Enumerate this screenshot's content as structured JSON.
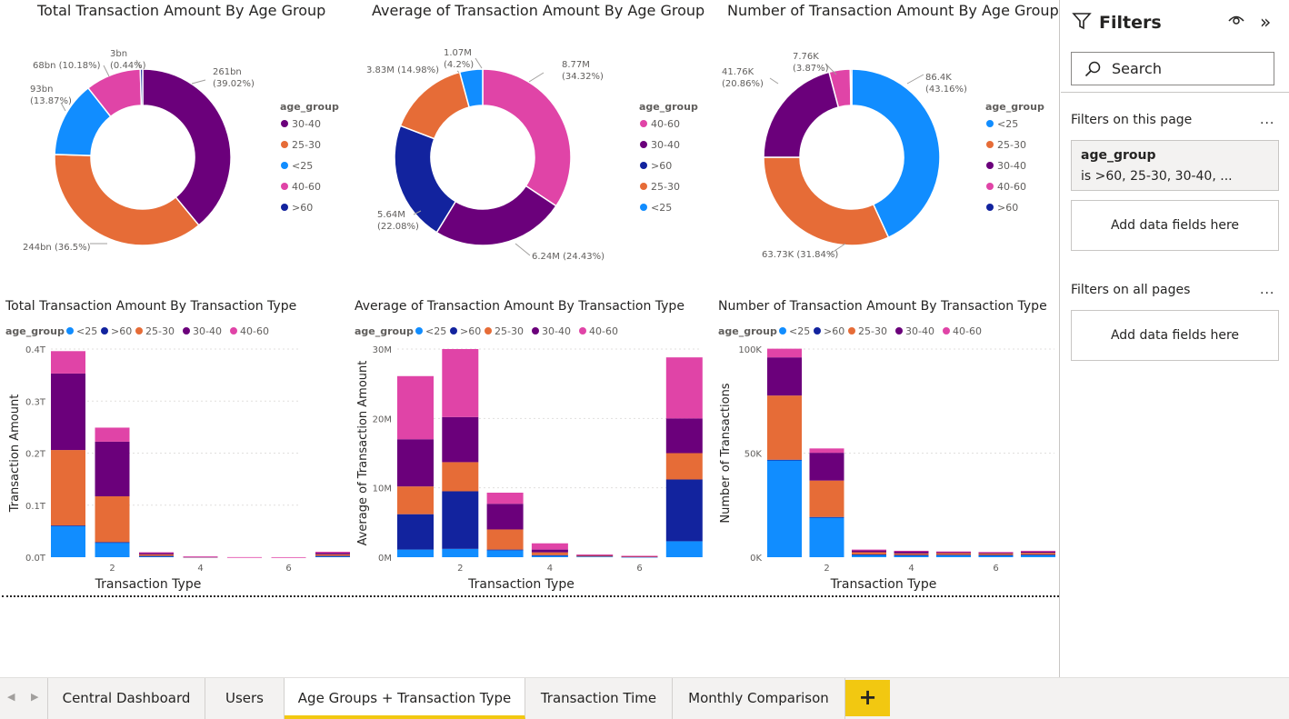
{
  "colors": {
    "lt25": "#118dff",
    "gt60": "#12239e",
    "c25_30": "#e66c37",
    "c30_40": "#6b007b",
    "c40_60": "#e044a7"
  },
  "donuts": [
    {
      "title": "Total Transaction Amount By Age Group",
      "legend_title": "age_group",
      "legend": [
        "30-40",
        "25-30",
        "<25",
        "40-60",
        ">60"
      ],
      "slices": [
        {
          "group": "30-40",
          "label": "261bn",
          "pct": "(39.02%)",
          "value": 39.02,
          "color": "#6b007b"
        },
        {
          "group": "25-30",
          "label": "244bn (36.5%)",
          "pct": "",
          "value": 36.5,
          "color": "#e66c37"
        },
        {
          "group": "<25",
          "label": "93bn",
          "pct": "(13.87%)",
          "value": 13.87,
          "color": "#118dff"
        },
        {
          "group": "40-60",
          "label": "68bn (10.18%)",
          "pct": "",
          "value": 10.18,
          "color": "#e044a7"
        },
        {
          "group": ">60",
          "label": "3bn",
          "pct": "(0.44%)",
          "value": 0.44,
          "color": "#12239e"
        }
      ]
    },
    {
      "title": "Average of Transaction Amount By Age Group",
      "legend_title": "age_group",
      "legend": [
        "40-60",
        "30-40",
        ">60",
        "25-30",
        "<25"
      ],
      "slices": [
        {
          "group": "40-60",
          "label": "8.77M",
          "pct": "(34.32%)",
          "value": 34.32,
          "color": "#e044a7"
        },
        {
          "group": "30-40",
          "label": "6.24M (24.43%)",
          "pct": "",
          "value": 24.43,
          "color": "#6b007b"
        },
        {
          "group": ">60",
          "label": "5.64M",
          "pct": "(22.08%)",
          "value": 22.08,
          "color": "#12239e"
        },
        {
          "group": "25-30",
          "label": "3.83M (14.98%)",
          "pct": "",
          "value": 14.98,
          "color": "#e66c37"
        },
        {
          "group": "<25",
          "label": "1.07M",
          "pct": "(4.2%)",
          "value": 4.2,
          "color": "#118dff"
        }
      ]
    },
    {
      "title": "Number of Transaction Amount By Age Group",
      "legend_title": "age_group",
      "legend": [
        "<25",
        "25-30",
        "30-40",
        "40-60",
        ">60"
      ],
      "slices": [
        {
          "group": "<25",
          "label": "86.4K",
          "pct": "(43.16%)",
          "value": 43.16,
          "color": "#118dff"
        },
        {
          "group": "25-30",
          "label": "63.73K (31.84%)",
          "pct": "",
          "value": 31.84,
          "color": "#e66c37"
        },
        {
          "group": "30-40",
          "label": "41.76K",
          "pct": "(20.86%)",
          "value": 20.86,
          "color": "#6b007b"
        },
        {
          "group": "40-60",
          "label": "7.76K",
          "pct": "(3.87%)",
          "value": 3.87,
          "color": "#e044a7"
        },
        {
          "group": ">60",
          "label": "",
          "pct": "",
          "value": 0.27,
          "color": "#12239e"
        }
      ]
    }
  ],
  "chart_data": [
    {
      "type": "pie",
      "title": "Total Transaction Amount By Age Group",
      "legend_title": "age_group",
      "labels": [
        "30-40",
        "25-30",
        "<25",
        "40-60",
        ">60"
      ],
      "values_bn": [
        261,
        244,
        93,
        68,
        3
      ],
      "percent": [
        39.02,
        36.5,
        13.87,
        10.18,
        0.44
      ]
    },
    {
      "type": "pie",
      "title": "Average of Transaction Amount By Age Group",
      "legend_title": "age_group",
      "labels": [
        "40-60",
        "30-40",
        ">60",
        "25-30",
        "<25"
      ],
      "values_M": [
        8.77,
        6.24,
        5.64,
        3.83,
        1.07
      ],
      "percent": [
        34.32,
        24.43,
        22.08,
        14.98,
        4.2
      ]
    },
    {
      "type": "pie",
      "title": "Number of Transaction Amount By Age Group",
      "legend_title": "age_group",
      "labels": [
        "<25",
        "25-30",
        "30-40",
        "40-60"
      ],
      "values_K": [
        86.4,
        63.73,
        41.76,
        7.76
      ],
      "percent": [
        43.16,
        31.84,
        20.86,
        3.87
      ]
    },
    {
      "type": "bar",
      "stacked": true,
      "title": "Total Transaction Amount By Transaction Type",
      "legend_title": "age_group",
      "legend": [
        "<25",
        ">60",
        "25-30",
        "30-40",
        "40-60"
      ],
      "xlabel": "Transaction Type",
      "ylabel": "Transaction Amount",
      "x": [
        1,
        2,
        3,
        4,
        5,
        6,
        7
      ],
      "xticks": [
        "2",
        "4",
        "6"
      ],
      "yticks": [
        "0.0T",
        "0.1T",
        "0.2T",
        "0.3T",
        "0.4T"
      ],
      "ylim": [
        0,
        0.4
      ],
      "series": [
        {
          "name": "<25",
          "color": "#118dff",
          "values": [
            0.06,
            0.028,
            0.002,
            0.0005,
            0,
            0,
            0.002
          ]
        },
        {
          "name": ">60",
          "color": "#12239e",
          "values": [
            0.001,
            0.001,
            0.0005,
            0,
            0,
            0,
            0.0005
          ]
        },
        {
          "name": "25-30",
          "color": "#e66c37",
          "values": [
            0.145,
            0.088,
            0.003,
            0.0003,
            0,
            0,
            0.003
          ]
        },
        {
          "name": "30-40",
          "color": "#6b007b",
          "values": [
            0.147,
            0.105,
            0.003,
            0.0002,
            0,
            0,
            0.003
          ]
        },
        {
          "name": "40-60",
          "color": "#e044a7",
          "values": [
            0.043,
            0.027,
            0.001,
            0.0005,
            0.0002,
            0.0001,
            0.002
          ]
        }
      ]
    },
    {
      "type": "bar",
      "stacked": true,
      "title": "Average of Transaction Amount By Transaction Type",
      "legend_title": "age_group",
      "legend": [
        "<25",
        ">60",
        "25-30",
        "30-40",
        "40-60"
      ],
      "xlabel": "Transaction Type",
      "ylabel": "Average of Transaction Amount",
      "x": [
        1,
        2,
        3,
        4,
        5,
        6,
        7
      ],
      "xticks": [
        "2",
        "4",
        "6"
      ],
      "yticks": [
        "0M",
        "10M",
        "20M",
        "30M"
      ],
      "ylim": [
        0,
        30
      ],
      "series": [
        {
          "name": "<25",
          "color": "#118dff",
          "values": [
            1.1,
            1.2,
            1.0,
            0.2,
            0.1,
            0.05,
            2.3
          ]
        },
        {
          "name": ">60",
          "color": "#12239e",
          "values": [
            5.1,
            8.3,
            0.1,
            0.1,
            0,
            0,
            8.9
          ]
        },
        {
          "name": "25-30",
          "color": "#e66c37",
          "values": [
            4.0,
            4.2,
            2.9,
            0.4,
            0.1,
            0.05,
            3.8
          ]
        },
        {
          "name": "30-40",
          "color": "#6b007b",
          "values": [
            6.8,
            6.5,
            3.7,
            0.4,
            0.1,
            0.05,
            5.0
          ]
        },
        {
          "name": "40-60",
          "color": "#e044a7",
          "values": [
            9.1,
            9.8,
            1.6,
            0.9,
            0.1,
            0.05,
            8.8
          ]
        }
      ]
    },
    {
      "type": "bar",
      "stacked": true,
      "title": "Number of Transaction Amount By Transaction Type",
      "legend_title": "age_group",
      "legend": [
        "<25",
        ">60",
        "25-30",
        "30-40",
        "40-60"
      ],
      "xlabel": "Transaction Type",
      "ylabel": "Number of Transactions",
      "x": [
        1,
        2,
        3,
        4,
        5,
        6,
        7
      ],
      "xticks": [
        "2",
        "4",
        "6"
      ],
      "yticks": [
        "0K",
        "50K",
        "100K"
      ],
      "ylim": [
        0,
        120
      ],
      "series": [
        {
          "name": "<25",
          "color": "#118dff",
          "values": [
            56,
            23,
            1.5,
            1.2,
            1.3,
            1.2,
            1.4
          ]
        },
        {
          "name": ">60",
          "color": "#12239e",
          "values": [
            0.2,
            0.2,
            0.1,
            0.1,
            0.1,
            0.1,
            0.1
          ]
        },
        {
          "name": "25-30",
          "color": "#e66c37",
          "values": [
            37,
            21,
            1.3,
            0.9,
            1.0,
            0.9,
            1.0
          ]
        },
        {
          "name": "30-40",
          "color": "#6b007b",
          "values": [
            22,
            16,
            1.0,
            1.2,
            0.6,
            0.5,
            0.8
          ]
        },
        {
          "name": "40-60",
          "color": "#e044a7",
          "values": [
            5,
            2.5,
            0.5,
            0.3,
            0.3,
            0.3,
            0.4
          ]
        }
      ]
    }
  ],
  "filters": {
    "title": "Filters",
    "search_placeholder": "Search",
    "on_this_page": "Filters on this page",
    "more": "...",
    "card_title": "age_group",
    "card_summary": "is >60, 25-30, 30-40, ...",
    "add_fields": "Add data fields here",
    "on_all_pages": "Filters on all pages"
  },
  "tabs": [
    "Central Dashboard",
    "Users",
    "Age Groups + Transaction Type",
    "Transaction Time",
    "Monthly Comparison"
  ],
  "active_tab": 2,
  "add_tab": "+"
}
